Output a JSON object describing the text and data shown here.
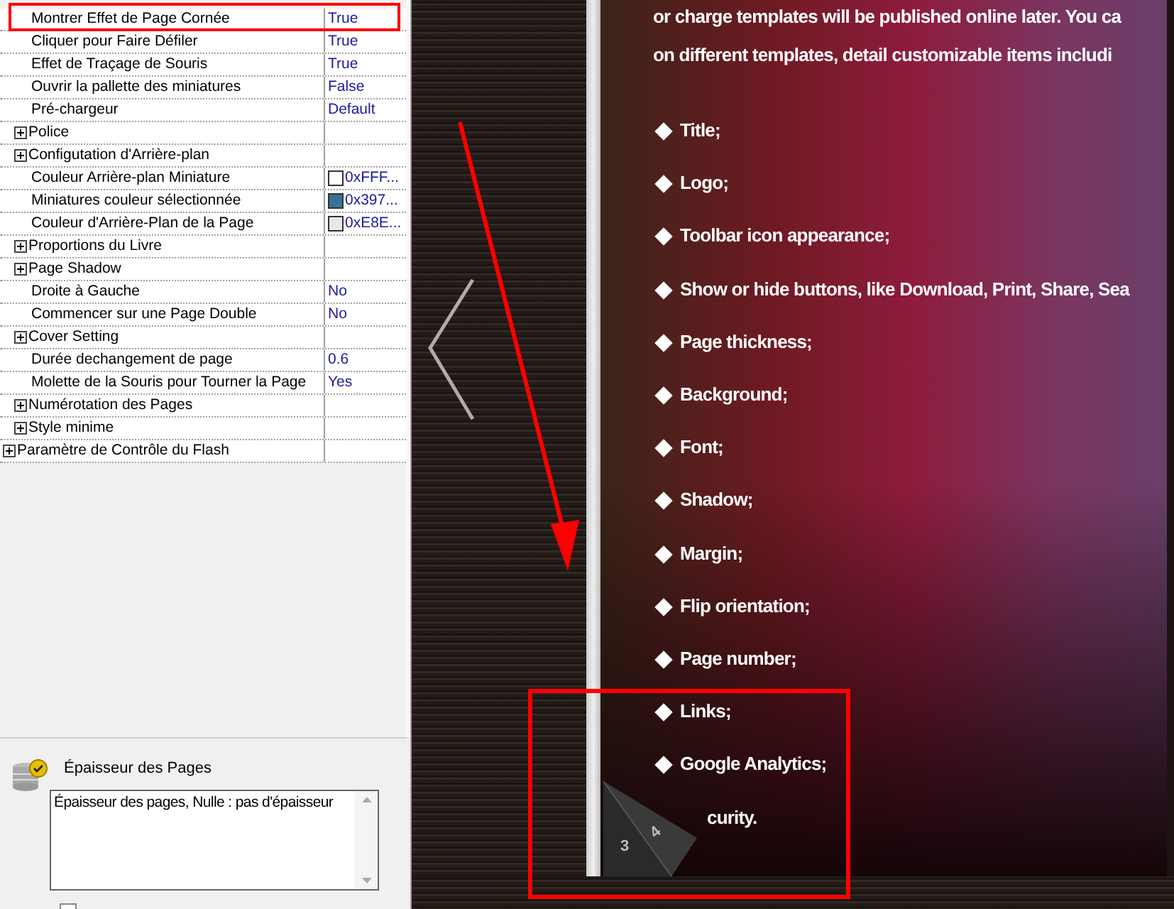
{
  "property_grid": {
    "visible_rows": [
      {
        "kind": "value",
        "label": "Montrer Effet de Page Cornée",
        "value": "True"
      },
      {
        "kind": "value",
        "label": "Cliquer pour Faire Défiler",
        "value": "True"
      },
      {
        "kind": "value",
        "label": "Effet de Traçage de Souris",
        "value": "True"
      },
      {
        "kind": "value",
        "label": "Ouvrir la pallette des miniatures",
        "value": "False"
      },
      {
        "kind": "value",
        "label": "Pré-chargeur",
        "value": "Default"
      },
      {
        "kind": "group",
        "label": "Police",
        "expanded": false
      },
      {
        "kind": "group",
        "label": "Configutation d'Arrière-plan",
        "expanded": false
      },
      {
        "kind": "color",
        "label": "Couleur Arrière-plan Miniature",
        "value": "0xFFF...",
        "color": "#ffffff"
      },
      {
        "kind": "color",
        "label": "Miniatures couleur sélectionnée",
        "value": "0x397...",
        "color": "#3a7199"
      },
      {
        "kind": "color",
        "label": "Couleur d'Arrière-Plan de la Page",
        "value": "0xE8E...",
        "color": "#e8e8e8"
      },
      {
        "kind": "group",
        "label": "Proportions du Livre",
        "expanded": false
      },
      {
        "kind": "group",
        "label": "Page Shadow",
        "expanded": false
      },
      {
        "kind": "value",
        "label": "Droite à Gauche",
        "value": "No"
      },
      {
        "kind": "value",
        "label": "Commencer sur une Page Double",
        "value": "No"
      },
      {
        "kind": "group",
        "label": "Cover Setting",
        "expanded": false
      },
      {
        "kind": "value",
        "label": "Durée dechangement de page",
        "value": "0.6"
      },
      {
        "kind": "value",
        "label": "Molette de la Souris pour Tourner la Page",
        "value": "Yes"
      },
      {
        "kind": "group",
        "label": "Numérotation des Pages",
        "expanded": false
      },
      {
        "kind": "group",
        "label": "Style minime",
        "expanded": false
      }
    ],
    "root_rows": [
      {
        "kind": "group",
        "label": "Paramètre de Contrôle du Flash",
        "expanded": false
      }
    ]
  },
  "description_panel": {
    "title": "Épaisseur des Pages",
    "text": "Épaisseur des pages, Nulle : pas d'épaisseur"
  },
  "bottom_checkbox": {
    "checked": false
  },
  "book_page": {
    "intro_lines": [
      "or charge templates will be published online later. You ca",
      "on different templates, detail customizable items includi"
    ],
    "bullets": [
      "Title;",
      "Logo;",
      "Toolbar icon appearance;",
      "Show or hide buttons, like Download, Print, Share, Sea",
      "Page thickness;",
      "Background;",
      "Font;",
      "Shadow;",
      "Margin;",
      "Flip orientation;",
      "Page number;",
      "Links;",
      "Google Analytics;"
    ],
    "partial_bullet": "curity.",
    "curl_page_numbers": [
      "3",
      "4"
    ]
  }
}
